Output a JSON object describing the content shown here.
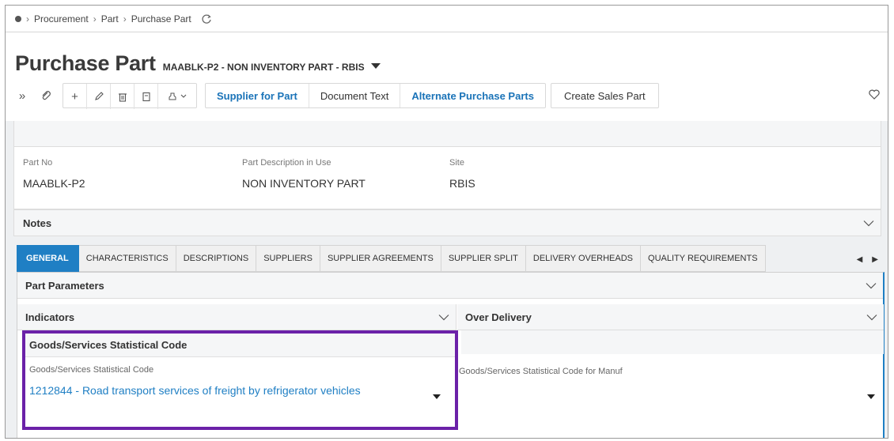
{
  "breadcrumb": {
    "items": [
      "Procurement",
      "Part",
      "Purchase Part"
    ]
  },
  "header": {
    "title": "Purchase Part",
    "subtitle": "MAABLK-P2 - NON INVENTORY PART - RBIS"
  },
  "toolbar": {
    "commands_group": [
      "Supplier for Part",
      "Document Text",
      "Alternate Purchase Parts"
    ],
    "create_sales_part": "Create Sales Part"
  },
  "fields": {
    "part_no": {
      "label": "Part No",
      "value": "MAABLK-P2"
    },
    "part_desc": {
      "label": "Part Description in Use",
      "value": "NON INVENTORY PART"
    },
    "site": {
      "label": "Site",
      "value": "RBIS"
    }
  },
  "notes": {
    "label": "Notes"
  },
  "tabs": [
    "GENERAL",
    "CHARACTERISTICS",
    "DESCRIPTIONS",
    "SUPPLIERS",
    "SUPPLIER AGREEMENTS",
    "SUPPLIER SPLIT",
    "DELIVERY OVERHEADS",
    "QUALITY REQUIREMENTS"
  ],
  "general": {
    "part_parameters": "Part Parameters",
    "indicators": "Indicators",
    "over_delivery": "Over Delivery",
    "stat_section": "Goods/Services Statistical Code",
    "stat_label": "Goods/Services Statistical Code",
    "stat_value": "1212844 - Road transport services of freight by refrigerator vehicles",
    "manuf_label": "Goods/Services Statistical Code for Manuf"
  },
  "colors": {
    "accent": "#1f7fc4",
    "highlight": "#6b21a8"
  }
}
